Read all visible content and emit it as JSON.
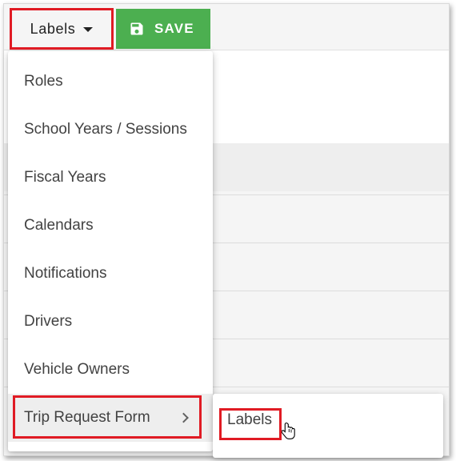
{
  "toolbar": {
    "labels_button": "Labels",
    "save_button": "SAVE",
    "save_color": "#4caf50"
  },
  "menu": {
    "items": [
      {
        "label": "Roles"
      },
      {
        "label": "School Years / Sessions"
      },
      {
        "label": "Fiscal Years"
      },
      {
        "label": "Calendars"
      },
      {
        "label": "Notifications"
      },
      {
        "label": "Drivers"
      },
      {
        "label": "Vehicle Owners"
      },
      {
        "label": "Trip Request Form",
        "has_submenu": true
      }
    ]
  },
  "submenu": {
    "items": [
      {
        "label": "Labels"
      }
    ]
  },
  "highlight_color": "#e01b24"
}
